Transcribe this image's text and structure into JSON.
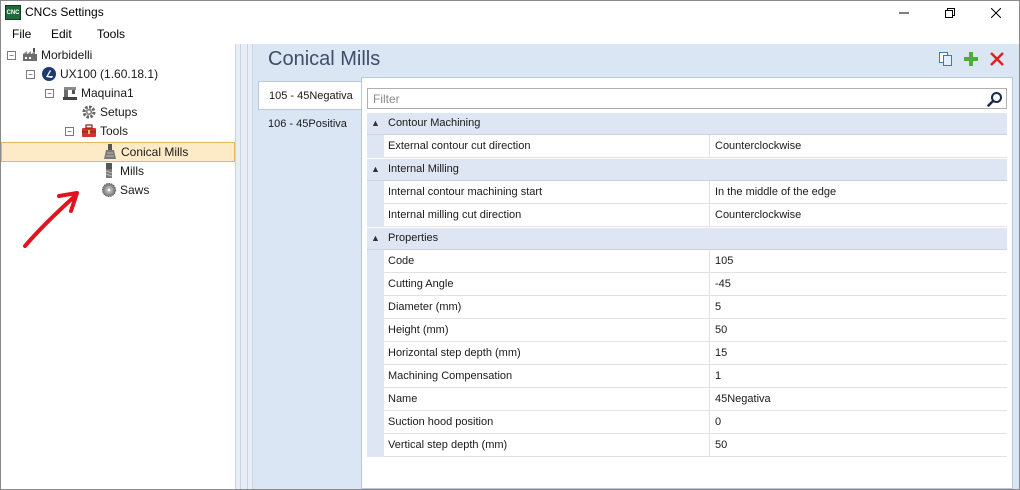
{
  "window": {
    "title": "CNCs Settings",
    "app_icon_text": "CNC"
  },
  "menu": {
    "items": [
      "File",
      "Edit",
      "Tools"
    ]
  },
  "tree": {
    "nodes": [
      {
        "label": "Morbidelli",
        "icon": "factory-icon",
        "expander": "minus"
      },
      {
        "label": "UX100 (1.60.18.1)",
        "icon": "machine-logo-icon",
        "expander": "minus"
      },
      {
        "label": "Maquina1",
        "icon": "machine-icon",
        "expander": "minus"
      },
      {
        "label": "Setups",
        "icon": "gear-icon"
      },
      {
        "label": "Tools",
        "icon": "toolbox-icon",
        "expander": "minus"
      },
      {
        "label": "Conical Mills",
        "icon": "conical-mill-icon",
        "selected": true
      },
      {
        "label": "Mills",
        "icon": "mill-icon"
      },
      {
        "label": "Saws",
        "icon": "saw-icon"
      }
    ]
  },
  "pane": {
    "title": "Conical Mills"
  },
  "tabs": [
    {
      "label": "105 - 45Negativa",
      "active": true
    },
    {
      "label": "106 - 45Positiva",
      "active": false
    }
  ],
  "filter": {
    "placeholder": "Filter"
  },
  "grid": {
    "categories": [
      {
        "label": "Contour Machining",
        "rows": [
          {
            "name": "External contour cut direction",
            "value": "Counterclockwise"
          }
        ]
      },
      {
        "label": "Internal Milling",
        "rows": [
          {
            "name": "Internal contour machining start",
            "value": "In the middle of the edge"
          },
          {
            "name": "Internal milling cut direction",
            "value": "Counterclockwise"
          }
        ]
      },
      {
        "label": "Properties",
        "rows": [
          {
            "name": "Code",
            "value": "105"
          },
          {
            "name": "Cutting Angle",
            "value": "-45"
          },
          {
            "name": "Diameter (mm)",
            "value": "5"
          },
          {
            "name": "Height (mm)",
            "value": "50"
          },
          {
            "name": "Horizontal step depth (mm)",
            "value": "15"
          },
          {
            "name": "Machining Compensation",
            "value": "1"
          },
          {
            "name": "Name",
            "value": "45Negativa"
          },
          {
            "name": "Suction hood position",
            "value": "0"
          },
          {
            "name": "Vertical step depth (mm)",
            "value": "50"
          }
        ]
      }
    ]
  },
  "colors": {
    "accent_title": "#3c4e6a",
    "pane_background": "#dbe6f4",
    "selection_background": "#fdebc8",
    "annotation_arrow": "#e0141e"
  }
}
